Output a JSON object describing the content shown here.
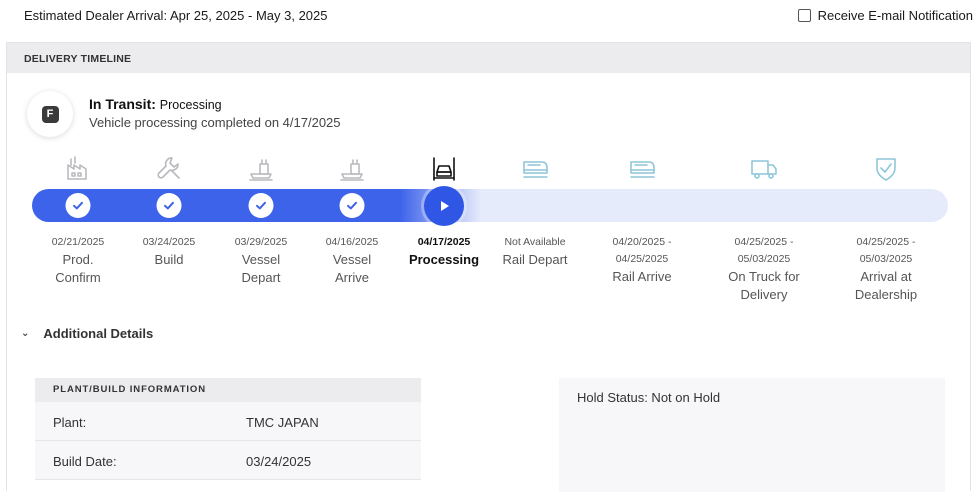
{
  "header": {
    "arrival_text": "Estimated Dealer Arrival: Apr 25, 2025 - May 3, 2025",
    "notify_label": "Receive E-mail Notification"
  },
  "panel": {
    "title": "DELIVERY TIMELINE"
  },
  "status": {
    "badge_letter": "F",
    "title_main": "In Transit: ",
    "title_sub": "Processing",
    "description": "Vehicle processing completed on 4/17/2025"
  },
  "steps": [
    {
      "date": "02/21/2025",
      "name": "Prod.\nConfirm",
      "state": "complete",
      "icon": "factory-icon"
    },
    {
      "date": "03/24/2025",
      "name": "Build",
      "state": "complete",
      "icon": "wrench-icon"
    },
    {
      "date": "03/29/2025",
      "name": "Vessel\nDepart",
      "state": "complete",
      "icon": "ship-icon"
    },
    {
      "date": "04/16/2025",
      "name": "Vessel\nArrive",
      "state": "complete",
      "icon": "ship-icon"
    },
    {
      "date": "04/17/2025",
      "name": "Processing",
      "state": "current",
      "icon": "car-lift-icon"
    },
    {
      "date": "Not Available",
      "name": "Rail Depart",
      "state": "upcoming",
      "icon": "train-icon"
    },
    {
      "date": "04/20/2025 -\n04/25/2025",
      "name": "Rail Arrive",
      "state": "upcoming",
      "icon": "train-icon"
    },
    {
      "date": "04/25/2025 -\n05/03/2025",
      "name": "On Truck for\nDelivery",
      "state": "upcoming",
      "icon": "truck-icon"
    },
    {
      "date": "04/25/2025 -\n05/03/2025",
      "name": "Arrival at\nDealership",
      "state": "upcoming",
      "icon": "shield-check-icon"
    }
  ],
  "progress_fraction": 0.49,
  "details": {
    "toggle_label": "Additional Details",
    "plant_section_title": "PLANT/BUILD INFORMATION",
    "rows": [
      {
        "key": "Plant:",
        "value": "TMC JAPAN"
      },
      {
        "key": "Build Date:",
        "value": "03/24/2025"
      }
    ],
    "hold_status": "Hold Status: Not on Hold"
  },
  "colors": {
    "accent": "#3d63ea",
    "accent_dark": "#2f56e5",
    "track": "#e6ebfb",
    "done_icon": "#b9b9bf",
    "upcoming_icon": "#8fc6da"
  }
}
